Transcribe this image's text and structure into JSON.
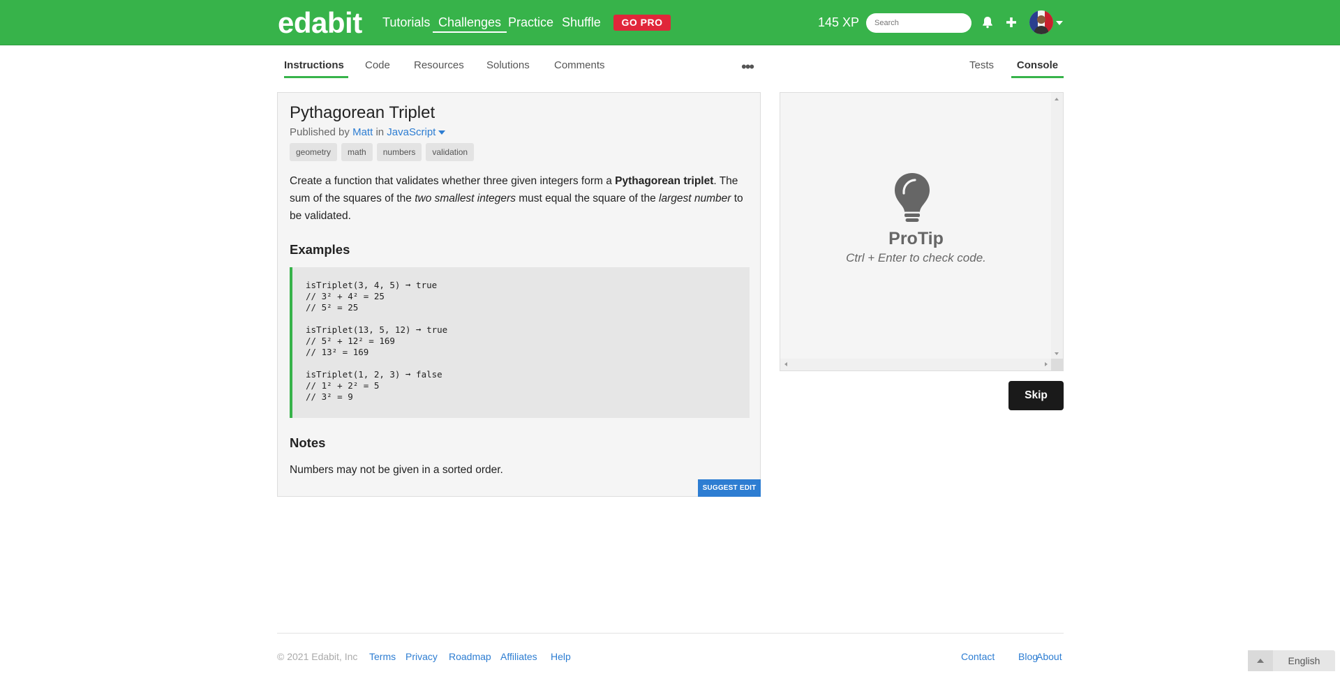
{
  "header": {
    "logo": "edabit",
    "nav": [
      {
        "label": "Tutorials"
      },
      {
        "label": "Challenges",
        "active": true
      },
      {
        "label": "Practice"
      },
      {
        "label": "Shuffle"
      }
    ],
    "gopro_label": "GO PRO",
    "xp": "145 XP",
    "search_placeholder": "Search",
    "icons": [
      "bell-icon",
      "plus-icon",
      "chevron-down-icon"
    ]
  },
  "tabs": {
    "left": [
      "Instructions",
      "Code",
      "Resources",
      "Solutions",
      "Comments"
    ],
    "right": [
      "Tests",
      "Console"
    ],
    "active_left": "Instructions",
    "active_right": "Console",
    "more_label": "•••"
  },
  "challenge": {
    "title": "Pythagorean Triplet",
    "published_prefix": "Published by",
    "author": "Matt",
    "in_word": "in",
    "language": "JavaScript",
    "tags": [
      "geometry",
      "math",
      "numbers",
      "validation"
    ],
    "description": {
      "p1_start": "Create a function that validates whether three given integers form a ",
      "p1_bold": "Pythagorean triplet",
      "p1_end": ". The sum of the squares of the ",
      "p1_italic1": "two smallest integers",
      "p1_mid": " must equal the square of the ",
      "p1_italic2": "largest number",
      "p1_tail": " to be validated."
    },
    "examples_heading": "Examples",
    "examples": [
      [
        "isTriplet(3, 4, 5) ➞ true",
        "// 3² + 4² = 25",
        "// 5² = 25"
      ],
      [
        "isTriplet(13, 5, 12) ➞ true",
        "// 5² + 12² = 169",
        "// 13² = 169"
      ],
      [
        "isTriplet(1, 2, 3) ➞ false",
        "// 1² + 2² = 5",
        "// 3² = 9"
      ]
    ],
    "notes_heading": "Notes",
    "notes": "Numbers may not be given in a sorted order.",
    "suggest_label": "SUGGEST EDIT"
  },
  "console": {
    "protip_title": "ProTip",
    "protip_text": "Ctrl + Enter to check code.",
    "icon": "lightbulb-icon"
  },
  "skip_label": "Skip",
  "footer": {
    "copyright": "© 2021 Edabit, Inc",
    "left_links": [
      "Terms",
      "Privacy",
      "Roadmap",
      "Affiliates",
      "Help"
    ],
    "right_links": [
      "Contact",
      "Blog",
      "About"
    ],
    "language": "English"
  },
  "colors": {
    "brand_green": "#37b34a",
    "gopro_red": "#e0263a",
    "link_blue": "#2d7dd2",
    "skip_black": "#1a1a1a"
  }
}
